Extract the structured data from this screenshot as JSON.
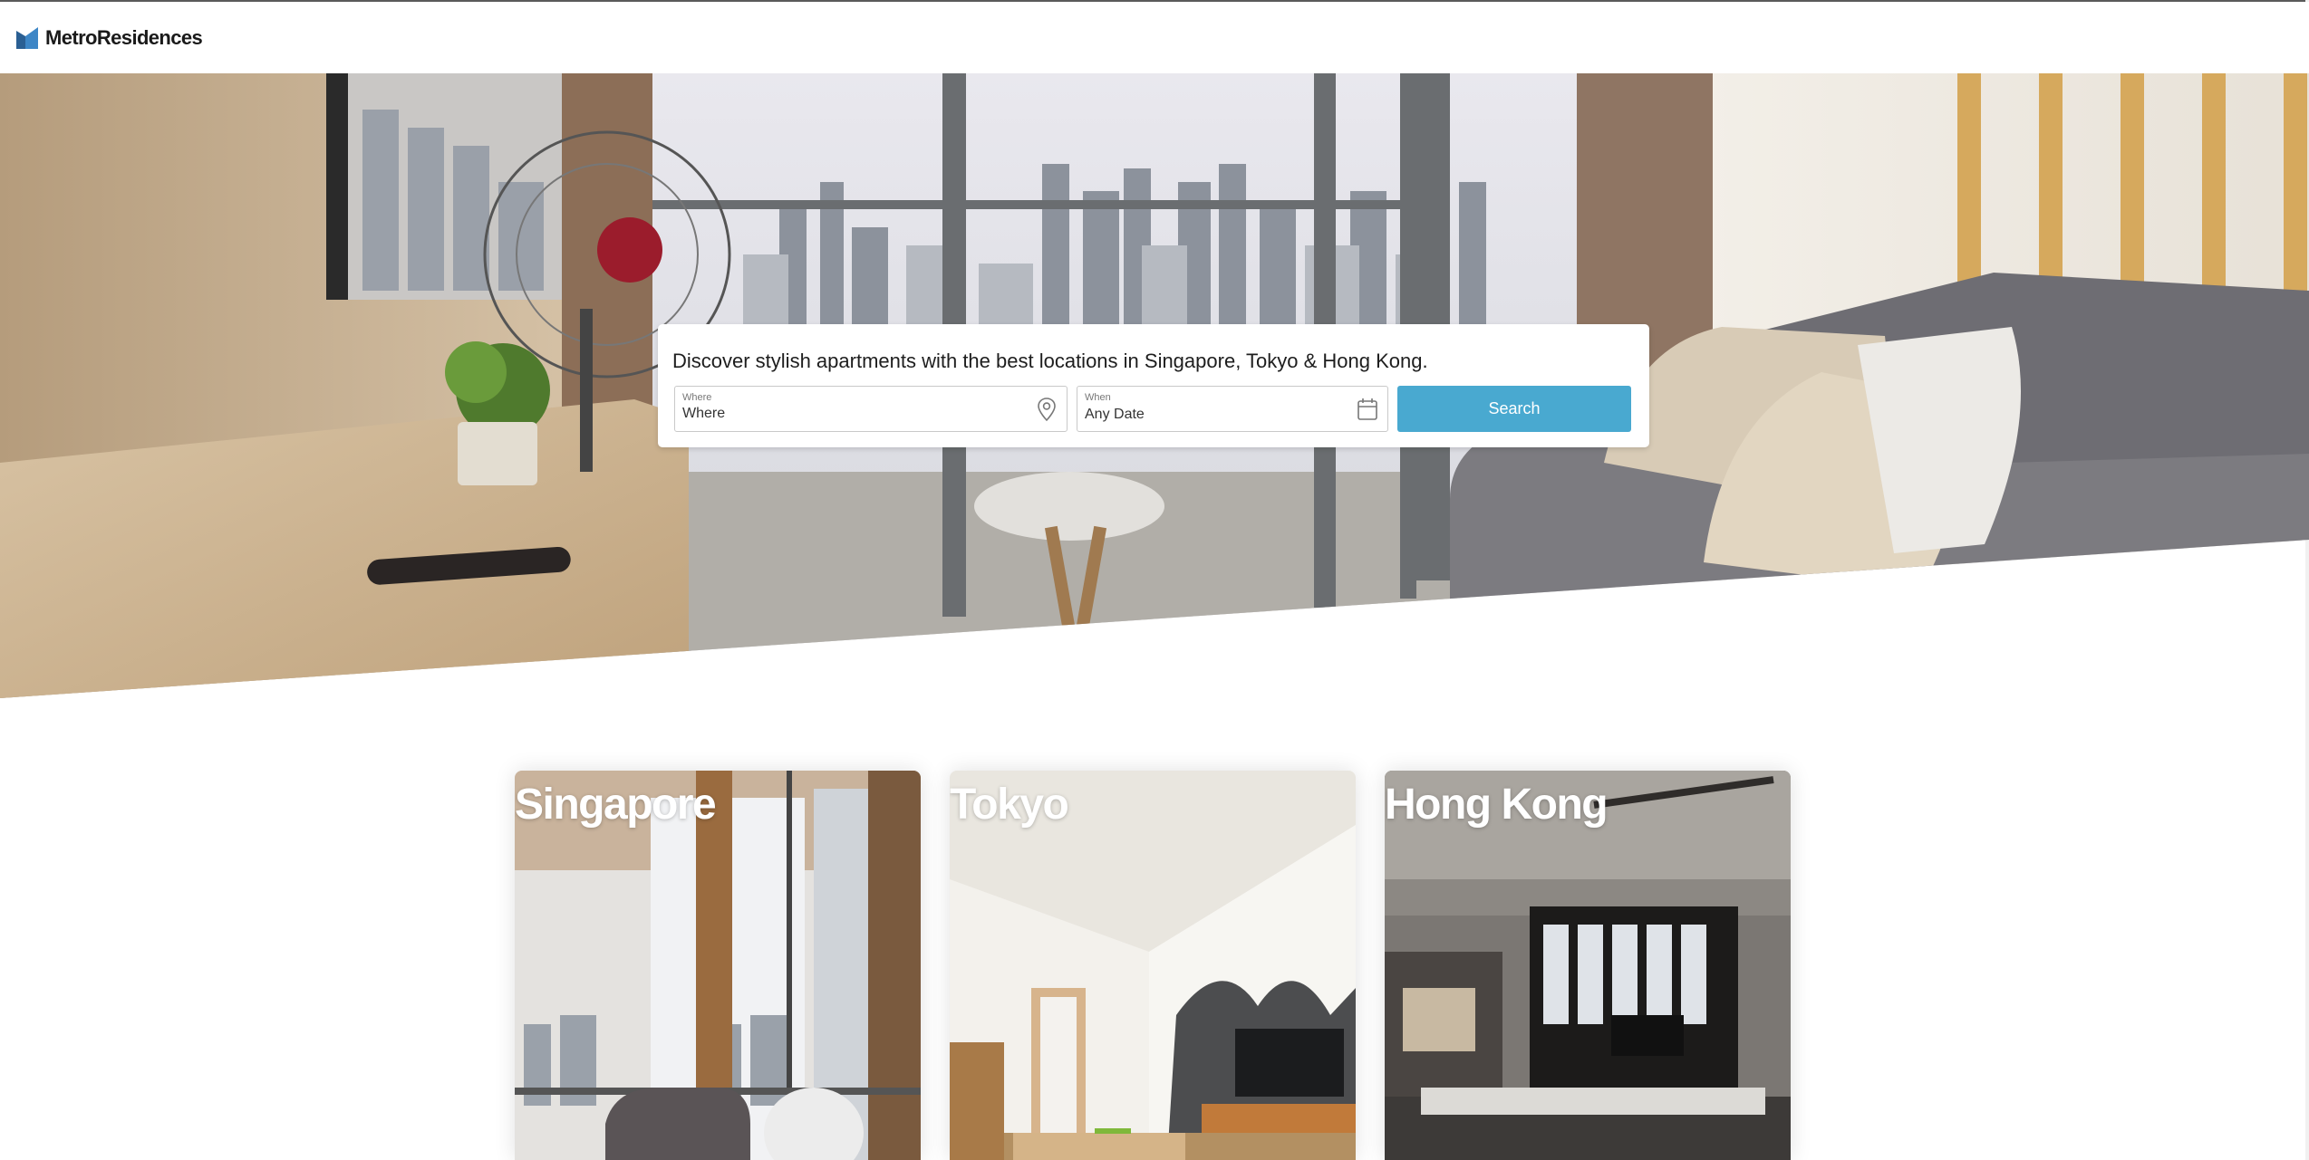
{
  "brand": {
    "name": "MetroResidences",
    "accent": "#2f6fa8"
  },
  "hero": {
    "headline": "Discover stylish apartments with the best locations in Singapore, Tokyo & Hong Kong.",
    "where": {
      "label": "Where",
      "placeholder": "Where",
      "icon": "map-pin-icon"
    },
    "when": {
      "label": "When",
      "value": "Any Date",
      "icon": "calendar-icon"
    },
    "search_button": "Search",
    "button_color": "#49a9d0"
  },
  "cities": [
    {
      "name": "Singapore"
    },
    {
      "name": "Tokyo"
    },
    {
      "name": "Hong Kong"
    }
  ]
}
